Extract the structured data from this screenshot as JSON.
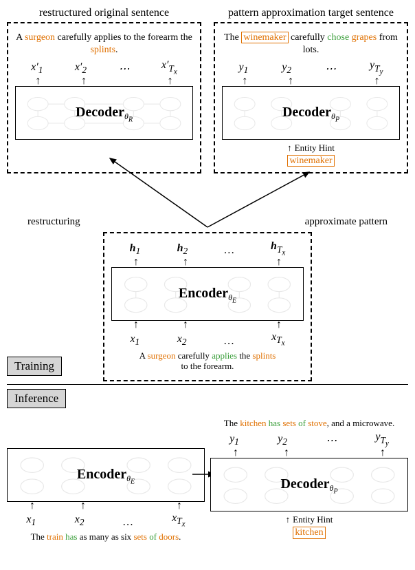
{
  "titles": {
    "left": "restructured original sentence",
    "right": "pattern approximation target sentence"
  },
  "restructured": {
    "sent_a": "A ",
    "sent_surgeon": "surgeon",
    "sent_b": " carefully applies to the forearm the ",
    "sent_splints": "splints",
    "sent_c": ".",
    "syms": [
      "x′₁",
      "x′₂",
      "…",
      "x′_{T_x}"
    ],
    "decoder": "Decoder",
    "theta": "θ_R"
  },
  "pattern": {
    "sent_a": "The ",
    "sent_winemaker": "winemaker",
    "sent_b": " carefully ",
    "sent_chose": "chose",
    "sent_c": " ",
    "sent_grapes": "grapes",
    "sent_d": " from lots.",
    "syms": [
      "y₁",
      "y₂",
      "…",
      "y_{T_y}"
    ],
    "decoder": "Decoder",
    "theta": "θ_P",
    "entity_hint_label": "Entity Hint",
    "entity_hint_value": "winemaker"
  },
  "mid_labels": {
    "left": "restructuring",
    "right": "approximate pattern"
  },
  "encoder": {
    "hsyms": [
      "h₁",
      "h₂",
      "…",
      "h_{T_x}"
    ],
    "label": "Encoder",
    "theta": "θ_E",
    "xsyms": [
      "x₁",
      "x₂",
      "…",
      "x_{T_x}"
    ],
    "sent_a": "A ",
    "sent_surgeon": "surgeon",
    "sent_b": " carefully ",
    "sent_applies": "applies",
    "sent_c": " the ",
    "sent_splints": "splints",
    "sent_d": " to the forearm."
  },
  "modes": {
    "training": "Training",
    "inference": "Inference"
  },
  "inference": {
    "encoder": {
      "label": "Encoder",
      "theta": "θ_E",
      "xsyms": [
        "x₁",
        "x₂",
        "…",
        "x_{T_x}"
      ],
      "sent_a": "The ",
      "sent_train": "train",
      "sent_b": " ",
      "sent_has": "has",
      "sent_c": " as many as six ",
      "sent_sets": "sets",
      "sent_d": " ",
      "sent_of": "of",
      "sent_e": " ",
      "sent_doors": "doors",
      "sent_f": "."
    },
    "decoder": {
      "sent_a": "The ",
      "sent_kitchen": "kitchen",
      "sent_b": " ",
      "sent_has": "has",
      "sent_c": " ",
      "sent_sets": "sets",
      "sent_d": " ",
      "sent_of": "of",
      "sent_e": " ",
      "sent_stove": "stove",
      "sent_f": ", and a microwave.",
      "ysyms": [
        "y₁",
        "y₂",
        "…",
        "y_{T_y}"
      ],
      "label": "Decoder",
      "theta": "θ_P",
      "entity_hint_label": "Entity Hint",
      "entity_hint_value": "kitchen"
    }
  }
}
